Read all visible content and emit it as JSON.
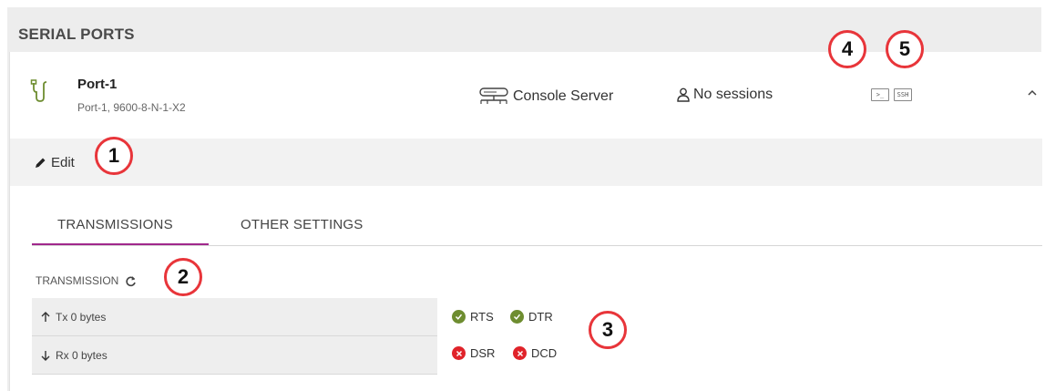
{
  "section_title": "SERIAL PORTS",
  "port": {
    "name": "Port-1",
    "description": "Port-1, 9600-8-N-1-X2",
    "mode": "Console Server",
    "sessions": "No sessions",
    "console_button": ">_",
    "ssh_button": "SSH"
  },
  "edit_label": "Edit",
  "tabs": [
    {
      "label": "TRANSMISSIONS",
      "active": true
    },
    {
      "label": "OTHER SETTINGS",
      "active": false
    }
  ],
  "transmission": {
    "title": "TRANSMISSION",
    "tx": "Tx 0 bytes",
    "rx": "Rx 0 bytes"
  },
  "signals": {
    "rts": "RTS",
    "dtr": "DTR",
    "dsr": "DSR",
    "dcd": "DCD"
  },
  "callouts": [
    "1",
    "2",
    "3",
    "4",
    "5"
  ],
  "colors": {
    "accent": "#a0288c",
    "ok": "#6e8d30",
    "error": "#e0232a",
    "callout_border": "#e8353a"
  }
}
